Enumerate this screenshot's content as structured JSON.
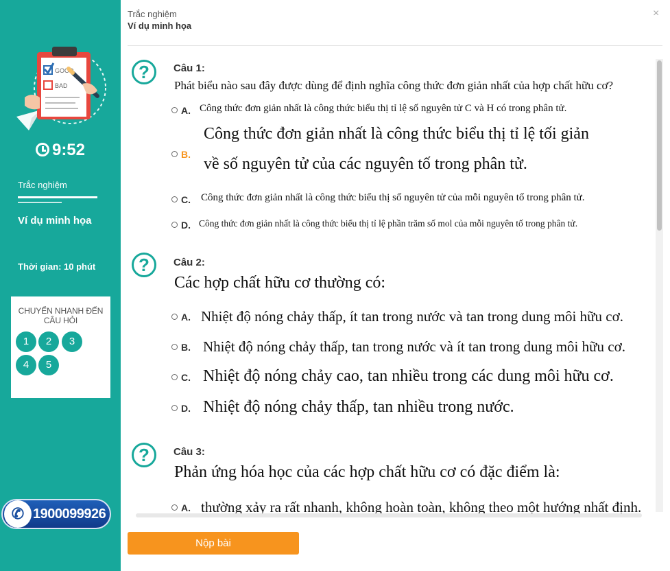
{
  "sidebar": {
    "timer": "9:52",
    "quiz_label": "Trắc nghiệm",
    "quiz_title": "Ví dụ minh họa",
    "time_info": "Thời gian: 10 phút",
    "jump_title": "CHUYỂN NHANH ĐẾN CÂU HỎI",
    "jump_buttons": [
      "1",
      "2",
      "3",
      "4",
      "5"
    ],
    "hotline": "1900099926",
    "art_text": {
      "good": "GOOD",
      "bad": "BAD"
    }
  },
  "header": {
    "subtitle": "Trắc nghiệm",
    "title": "Ví dụ minh họa",
    "close": "×"
  },
  "questions": [
    {
      "label": "Câu 1:",
      "text": "Phát biểu nào sau đây được dùng để định nghĩa công thức đơn giản nhất của hợp chất hữu cơ?",
      "options": [
        {
          "letter": "A.",
          "text": "Công thức đơn giản nhất là công thức biểu thị tỉ lệ số nguyên tử C và H có trong phân tử."
        },
        {
          "letter": "B.",
          "text_line1": "Công thức đơn giản nhất là công thức biểu thị tỉ lệ tối giản",
          "text_line2": "về số nguyên tử của các nguyên tố trong phân tử."
        },
        {
          "letter": "C.",
          "text": "Công thức đơn giản nhất là công thức biểu thị số nguyên tử của mỗi nguyên tố trong phân tử."
        },
        {
          "letter": "D.",
          "text": "Công thức đơn giản nhất là công thức biểu thị tỉ lệ phần trăm số mol của mỗi nguyên tố trong phân tử."
        }
      ]
    },
    {
      "label": "Câu 2:",
      "text": "Các hợp chất hữu cơ thường có:",
      "options": [
        {
          "letter": "A.",
          "text": "Nhiệt độ nóng chảy thấp, ít tan trong nước và tan trong dung môi hữu cơ."
        },
        {
          "letter": "B.",
          "text": "Nhiệt độ nóng chảy thấp, tan trong nước và ít tan trong dung môi hữu cơ."
        },
        {
          "letter": "C.",
          "text": "Nhiệt độ nóng chảy cao, tan nhiều trong các dung môi hữu cơ."
        },
        {
          "letter": "D.",
          "text": "Nhiệt độ nóng chảy thấp, tan nhiều trong nước."
        }
      ]
    },
    {
      "label": "Câu 3:",
      "text": "Phản ứng hóa học của các hợp chất hữu cơ có đặc điểm là:",
      "options": [
        {
          "letter": "A.",
          "text": "thường xảy ra rất nhanh, không hoàn toàn, không theo một hướng nhất định."
        }
      ]
    }
  ],
  "submit_label": "Nộp bài",
  "colors": {
    "teal": "#17a89b",
    "orange": "#f7941e",
    "highlight_letter": "#f7941e",
    "hotline_blue": "#1a4fa0"
  }
}
